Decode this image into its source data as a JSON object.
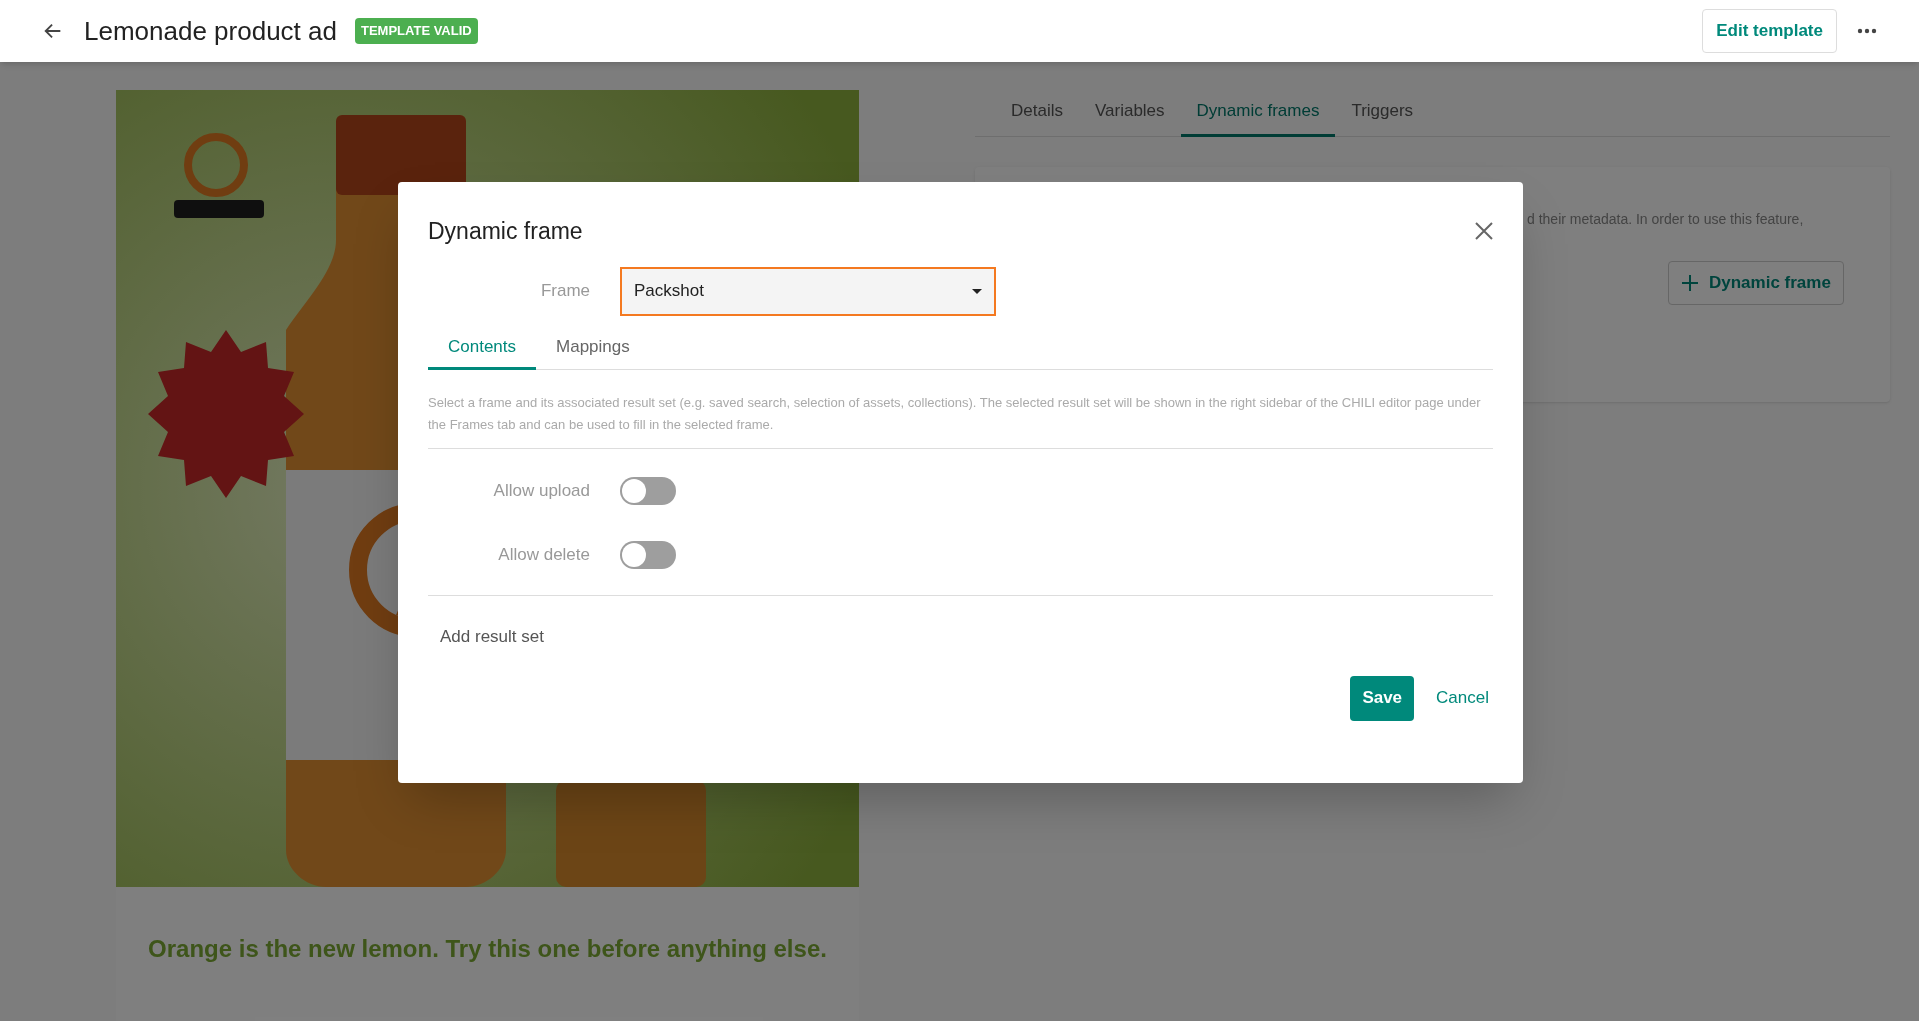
{
  "header": {
    "title": "Lemonade product ad",
    "badge": "TEMPLATE VALID",
    "edit_button": "Edit template"
  },
  "preview": {
    "kind": "picture",
    "tagline": "Orange is the new lemon. Try this one before anything else."
  },
  "tabs": [
    {
      "label": "Details",
      "selected": false
    },
    {
      "label": "Variables",
      "selected": false
    },
    {
      "label": "Dynamic frames",
      "selected": true
    },
    {
      "label": "Triggers",
      "selected": false
    }
  ],
  "panel": {
    "text_fragment": "d their metadata. In order to use this feature,",
    "add_button": "Dynamic frame"
  },
  "dialog": {
    "title": "Dynamic frame",
    "frame_label": "Frame",
    "frame_value": "Packshot",
    "tabs": [
      {
        "label": "Contents",
        "selected": true
      },
      {
        "label": "Mappings",
        "selected": false
      }
    ],
    "description": "Select a frame and its associated result set (e.g. saved search, selection of assets, collections). The selected result set will be shown in the right sidebar of the CHILI editor page under the Frames tab and can be used to fill in the selected frame.",
    "toggles": [
      {
        "label": "Allow upload",
        "on": false
      },
      {
        "label": "Allow delete",
        "on": false
      }
    ],
    "add_result_set": "Add result set",
    "save": "Save",
    "cancel": "Cancel"
  }
}
